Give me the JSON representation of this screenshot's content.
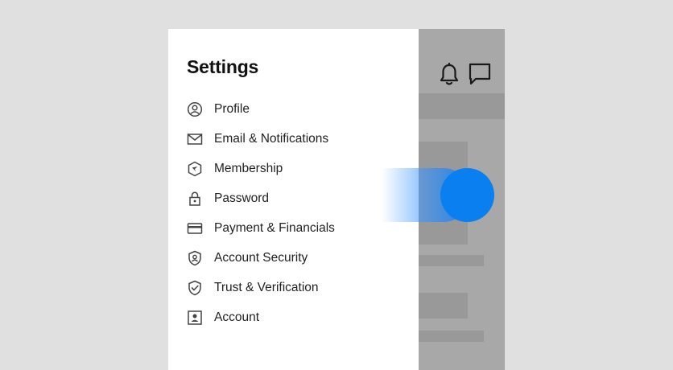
{
  "drawer": {
    "title": "Settings",
    "items": [
      {
        "label": "Profile",
        "icon": "profile-icon"
      },
      {
        "label": "Email & Notifications",
        "icon": "mail-icon"
      },
      {
        "label": "Membership",
        "icon": "membership-icon"
      },
      {
        "label": "Password",
        "icon": "lock-icon"
      },
      {
        "label": "Payment & Financials",
        "icon": "credit-card-icon"
      },
      {
        "label": "Account Security",
        "icon": "shield-user-icon"
      },
      {
        "label": "Trust & Verification",
        "icon": "shield-check-icon"
      },
      {
        "label": "Account",
        "icon": "account-card-icon"
      }
    ]
  },
  "header_icons": [
    "bell-icon",
    "chat-icon"
  ],
  "colors": {
    "backdrop": "#e0e0e0",
    "drawer_bg": "#ffffff",
    "dimmed_app": "#a8a8a8",
    "swipe_accent": "#0a7ff0",
    "text": "#222222",
    "icon": "#444444"
  }
}
